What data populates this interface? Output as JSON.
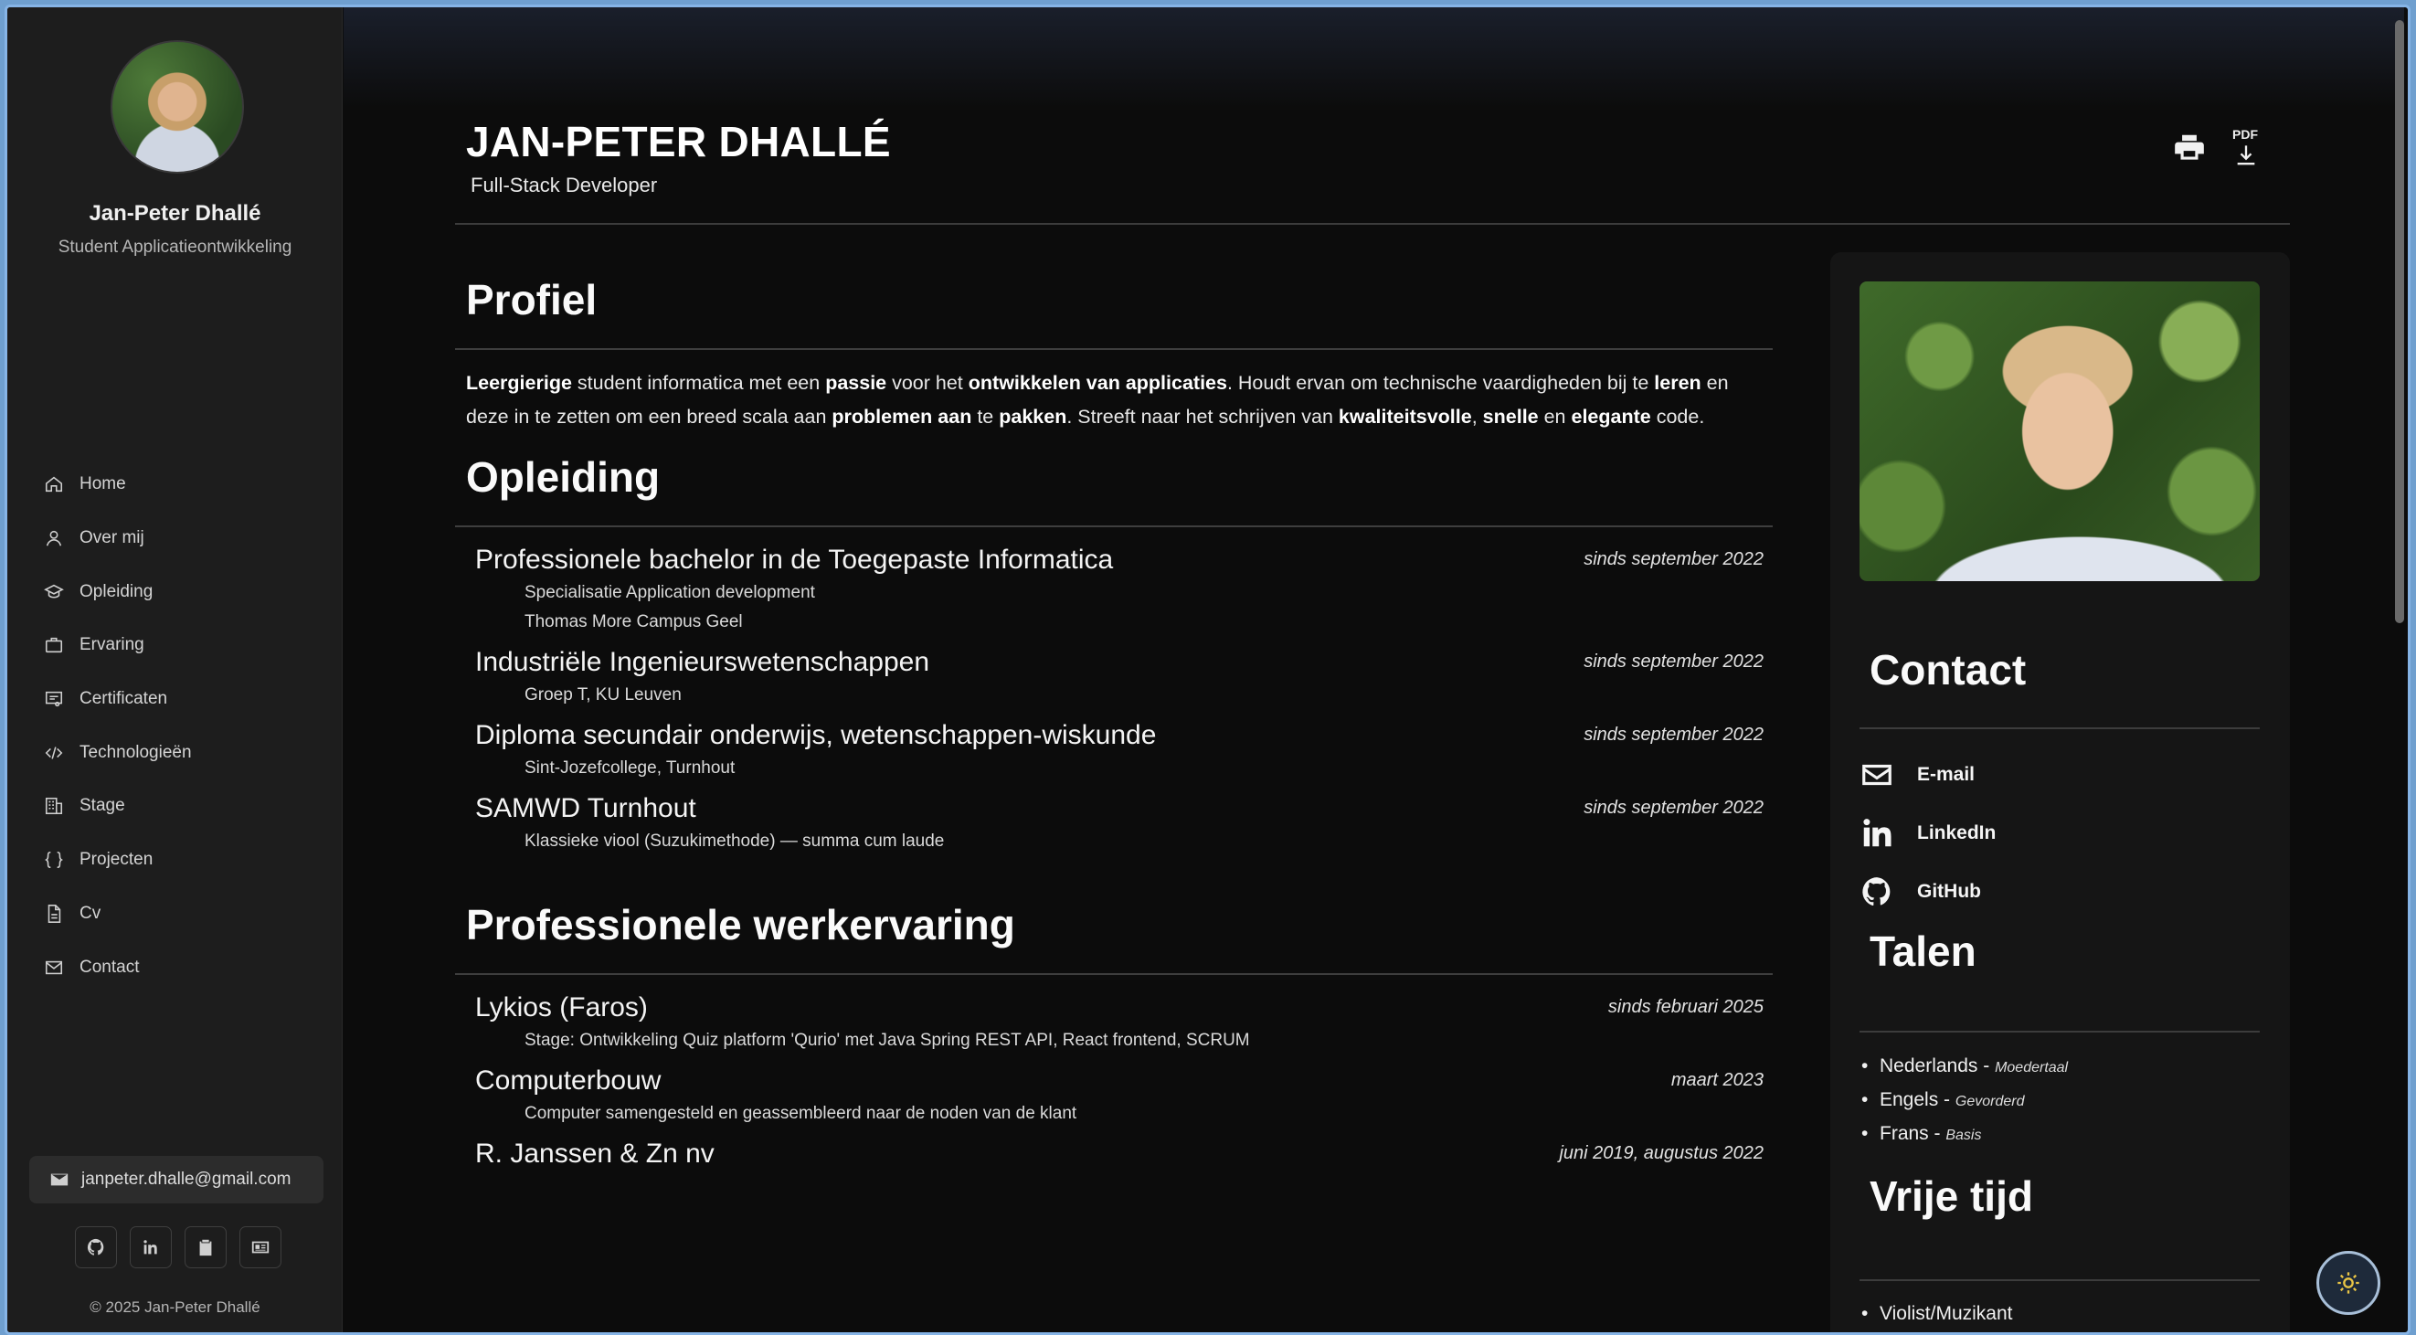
{
  "sidebar": {
    "name": "Jan-Peter Dhallé",
    "role": "Student Applicatieontwikkeling",
    "nav": [
      {
        "label": "Home",
        "icon": "home-icon"
      },
      {
        "label": "Over mij",
        "icon": "user-icon"
      },
      {
        "label": "Opleiding",
        "icon": "graduation-cap-icon"
      },
      {
        "label": "Ervaring",
        "icon": "briefcase-icon"
      },
      {
        "label": "Certificaten",
        "icon": "certificate-icon"
      },
      {
        "label": "Technologieën",
        "icon": "code-icon"
      },
      {
        "label": "Stage",
        "icon": "building-icon"
      },
      {
        "label": "Projecten",
        "icon": "braces-icon"
      },
      {
        "label": "Cv",
        "icon": "document-icon"
      },
      {
        "label": "Contact",
        "icon": "mail-icon"
      }
    ],
    "email": "janpeter.dhalle@gmail.com",
    "socials": [
      "github-icon",
      "linkedin-icon",
      "clipboard-icon",
      "id-card-icon"
    ],
    "copyright": "© 2025 Jan-Peter Dhallé"
  },
  "header": {
    "name": "JAN-PETER DHALLÉ",
    "title": "Full-Stack Developer",
    "pdf_label": "PDF"
  },
  "profile": {
    "heading": "Profiel",
    "parts": [
      {
        "t": "Leergierige",
        "b": true
      },
      {
        "t": " student informatica met een ",
        "b": false
      },
      {
        "t": "passie",
        "b": true
      },
      {
        "t": " voor het ",
        "b": false
      },
      {
        "t": "ontwikkelen van applicaties",
        "b": true
      },
      {
        "t": ". Houdt ervan om technische vaardigheden bij te ",
        "b": false
      },
      {
        "t": "leren",
        "b": true
      },
      {
        "t": " en deze in te zetten om een breed scala aan ",
        "b": false
      },
      {
        "t": "problemen aan",
        "b": true
      },
      {
        "t": " te ",
        "b": false
      },
      {
        "t": "pakken",
        "b": true
      },
      {
        "t": ". Streeft naar het schrijven van ",
        "b": false
      },
      {
        "t": "kwaliteitsvolle",
        "b": true
      },
      {
        "t": ", ",
        "b": false
      },
      {
        "t": "snelle",
        "b": true
      },
      {
        "t": " en ",
        "b": false
      },
      {
        "t": "elegante",
        "b": true
      },
      {
        "t": " code.",
        "b": false
      }
    ]
  },
  "education": {
    "heading": "Opleiding",
    "items": [
      {
        "title": "Professionele bachelor in de Toegepaste Informatica",
        "date": "sinds september 2022",
        "sub": [
          "Specialisatie Application development",
          "Thomas More Campus Geel"
        ]
      },
      {
        "title": "Industriële Ingenieurswetenschappen",
        "date": "sinds september 2022",
        "sub": [
          "Groep T, KU Leuven"
        ]
      },
      {
        "title": "Diploma secundair onderwijs, wetenschappen-wiskunde",
        "date": "sinds september 2022",
        "sub": [
          "Sint-Jozefcollege, Turnhout"
        ]
      },
      {
        "title": "SAMWD Turnhout",
        "date": "sinds september 2022",
        "sub": [
          "Klassieke viool (Suzukimethode) — summa cum laude"
        ]
      }
    ]
  },
  "experience": {
    "heading": "Professionele werkervaring",
    "items": [
      {
        "title": "Lykios (Faros)",
        "date": "sinds februari 2025",
        "sub": [
          "Stage: Ontwikkeling Quiz platform 'Qurio' met Java Spring REST API, React frontend, SCRUM"
        ]
      },
      {
        "title": "Computerbouw",
        "date": "maart 2023",
        "sub": [
          "Computer samengesteld en geassembleerd naar de noden van de klant"
        ]
      },
      {
        "title": "R. Janssen & Zn nv",
        "date": "juni 2019, augustus 2022",
        "sub": []
      }
    ]
  },
  "card": {
    "contact_heading": "Contact",
    "links": [
      {
        "label": "E-mail",
        "icon": "mail-icon"
      },
      {
        "label": "LinkedIn",
        "icon": "linkedin-icon"
      },
      {
        "label": "GitHub",
        "icon": "github-icon"
      }
    ],
    "languages_heading": "Talen",
    "languages": [
      {
        "name": "Nederlands - ",
        "level": "Moedertaal"
      },
      {
        "name": "Engels - ",
        "level": "Gevorderd"
      },
      {
        "name": "Frans - ",
        "level": "Basis"
      }
    ],
    "hobby_heading": "Vrije tijd",
    "hobbies": [
      "Violist/Muzikant"
    ]
  }
}
